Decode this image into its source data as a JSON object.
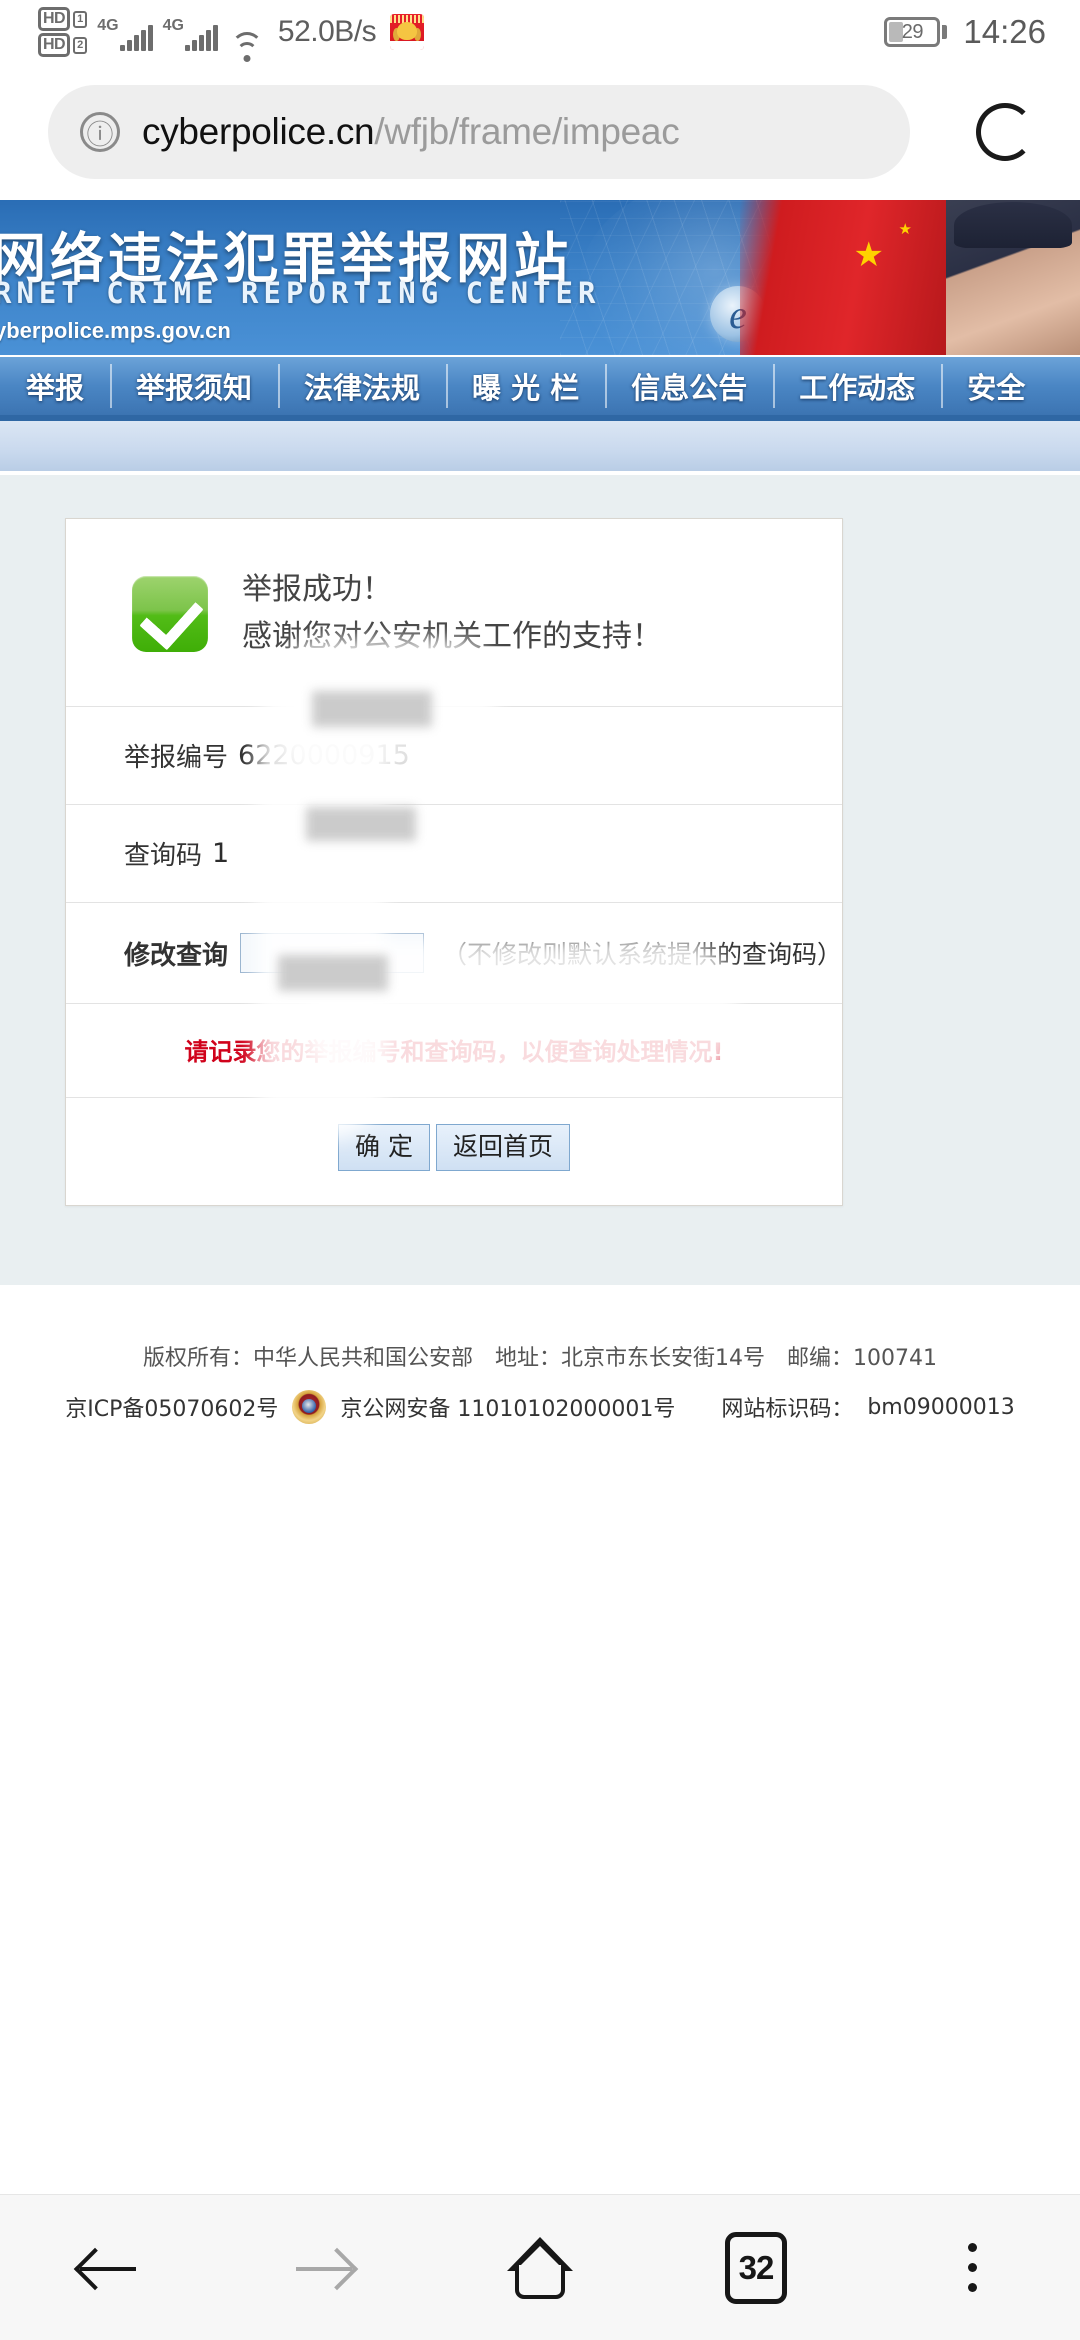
{
  "status_bar": {
    "hd1_label": "HD",
    "hd1_index": "1",
    "hd2_label": "HD",
    "hd2_index": "2",
    "network_1": "4G",
    "network_2": "4G",
    "net_speed": "52.0B/s",
    "app_icon": "red-app-icon",
    "battery_percent": "29",
    "time": "14:26"
  },
  "browser": {
    "info_icon": "ⓘ",
    "url_host": "cyberpolice.cn",
    "url_path": "/wfjb/frame/impeac",
    "reload_state": "loading-spinner"
  },
  "site": {
    "banner": {
      "title_cn": "网络违法犯罪举报网站",
      "title_en": "RNET CRIME REPORTING CENTER",
      "url": "yberpolice.mps.gov.cn"
    },
    "nav_items": [
      {
        "label": "举报"
      },
      {
        "label": "举报须知"
      },
      {
        "label": "法律法规"
      },
      {
        "label": "曝 光 栏"
      },
      {
        "label": "信息公告"
      },
      {
        "label": "工作动态"
      },
      {
        "label": "安全"
      }
    ]
  },
  "card": {
    "success_icon": "green-check-icon",
    "headline_1": "举报成功！",
    "headline_2": "感谢您对公安机关工作的支持！",
    "rows": [
      {
        "label": "举报编号",
        "value": "6220000915"
      },
      {
        "label": "查询码",
        "value": "1"
      }
    ],
    "modify_row": {
      "label": "修改查询",
      "input_value": "",
      "hint": "（不修改则默认系统提供的查询码）"
    },
    "warning": "请记录您的举报编号和查询码，以便查询处理情况!",
    "buttons": [
      {
        "label": "确 定"
      },
      {
        "label": "返回首页"
      }
    ]
  },
  "footer": {
    "line1": "版权所有：中华人民共和国公安部　地址：北京市东长安街14号　邮编：100741",
    "icp": "京ICP备05070602号",
    "badge_icon": "police-badge-icon",
    "beian": "京公网安备 11010102000001号",
    "site_id_label": "网站标识码：",
    "site_id": "bm09000013"
  },
  "bottom_nav": {
    "back": "back-arrow",
    "forward": "forward-arrow",
    "home": "home-icon",
    "tab_count": "32",
    "menu": "more-menu"
  }
}
